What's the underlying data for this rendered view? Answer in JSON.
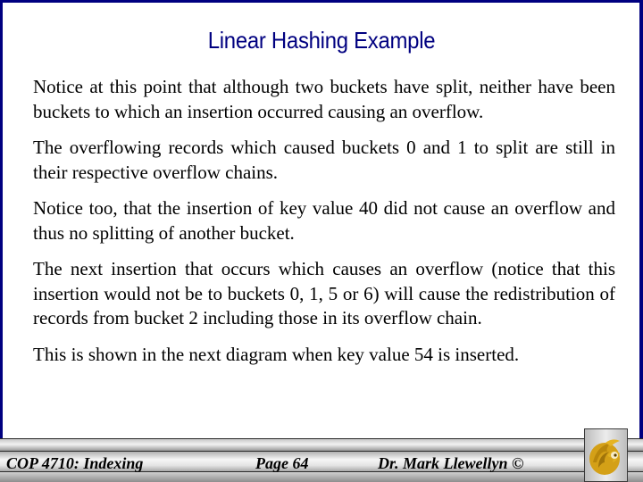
{
  "slide": {
    "title": "Linear Hashing Example",
    "paragraphs": [
      "Notice at this point that although two buckets have split, neither have been buckets to which an insertion occurred causing an overflow.",
      "The overflowing records which caused buckets 0 and 1 to split are still in their respective overflow chains.",
      "Notice too, that the insertion of key value 40 did not cause an overflow and thus no splitting of another bucket.",
      "The next insertion that occurs which causes an overflow (notice that this insertion would not be to buckets 0, 1, 5 or 6) will cause the redistribution of records from bucket 2 including those in its overflow chain.",
      "This is shown in the next diagram when key value 54 is inserted."
    ]
  },
  "footer": {
    "course": "COP 4710: Indexing",
    "page": "Page 64",
    "author": "Dr. Mark Llewellyn ©",
    "logo_icon": "pegasus-logo-icon"
  },
  "colors": {
    "frame": "#000080",
    "title": "#000080",
    "logo_gold": "#d4a017"
  }
}
